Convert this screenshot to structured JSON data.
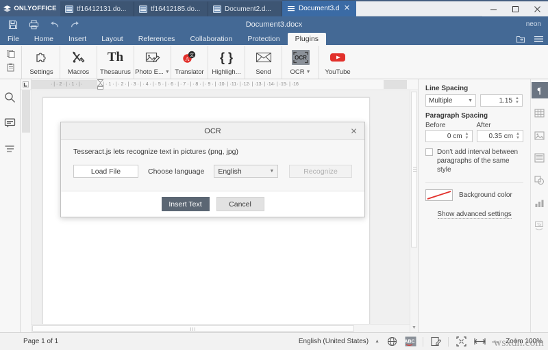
{
  "app": {
    "brand": "ONLYOFFICE",
    "user": "neon",
    "document_title": "Document3.docx"
  },
  "tabs": [
    {
      "label": "tf16412131.do...",
      "active": false
    },
    {
      "label": "tf16412185.do...",
      "active": false
    },
    {
      "label": "Document2.d...",
      "active": false
    },
    {
      "label": "Document3.d...",
      "active": true
    }
  ],
  "window_buttons": {
    "minimize": "—",
    "maximize": "☐",
    "close": "✕"
  },
  "quick_access": [
    "save-icon",
    "print-icon",
    "undo-icon",
    "redo-icon"
  ],
  "menu": {
    "items": [
      {
        "label": "File",
        "active": false
      },
      {
        "label": "Home",
        "active": false
      },
      {
        "label": "Insert",
        "active": false
      },
      {
        "label": "Layout",
        "active": false
      },
      {
        "label": "References",
        "active": false
      },
      {
        "label": "Collaboration",
        "active": false
      },
      {
        "label": "Protection",
        "active": false
      },
      {
        "label": "Plugins",
        "active": true
      }
    ]
  },
  "ribbon": {
    "plugins": [
      {
        "label": "Settings",
        "icon": "puzzle-icon",
        "caret": false,
        "selected": false
      },
      {
        "label": "Macros",
        "icon": "tools-icon",
        "caret": false,
        "selected": false
      },
      {
        "label": "Thesaurus",
        "icon": "th-icon",
        "caret": false,
        "selected": false
      },
      {
        "label": "Photo E...",
        "icon": "photo-editor-icon",
        "caret": true,
        "selected": false
      },
      {
        "label": "Translator",
        "icon": "translator-icon",
        "caret": false,
        "selected": false
      },
      {
        "label": "Highligh...",
        "icon": "braces-icon",
        "caret": false,
        "selected": false
      },
      {
        "label": "Send",
        "icon": "envelope-icon",
        "caret": false,
        "selected": false
      },
      {
        "label": "OCR",
        "icon": "ocr-icon",
        "caret": true,
        "selected": true
      },
      {
        "label": "YouTube",
        "icon": "youtube-icon",
        "caret": false,
        "selected": false
      }
    ]
  },
  "left_rail": [
    {
      "name": "search-icon"
    },
    {
      "name": "comments-icon"
    },
    {
      "name": "headings-icon"
    }
  ],
  "right_rail": [
    {
      "name": "paragraph-settings-icon",
      "active": true
    },
    {
      "name": "table-settings-icon",
      "active": false
    },
    {
      "name": "image-settings-icon",
      "active": false
    },
    {
      "name": "header-footer-settings-icon",
      "active": false
    },
    {
      "name": "shape-settings-icon",
      "active": false
    },
    {
      "name": "chart-settings-icon",
      "active": false
    },
    {
      "name": "text-art-settings-icon",
      "active": false
    }
  ],
  "right_panel": {
    "line_spacing_title": "Line Spacing",
    "line_spacing_mode": "Multiple",
    "line_spacing_value": "1.15",
    "paragraph_spacing_title": "Paragraph Spacing",
    "before_label": "Before",
    "after_label": "After",
    "before_value": "0 cm",
    "after_value": "0.35 cm",
    "no_interval_text": "Don't add interval between paragraphs of the same style",
    "background_color_label": "Background color",
    "advanced_label": "Show advanced settings"
  },
  "ruler": {
    "horizontal_ticks": "· | · 2 · | · 1 · | ·",
    "horizontal_scale": "· | · 1 · | · 2 · | · 3 · | · 4 · | · 5 · | · 6 · | · 7 · | · 8 · | · 9 · | ·10· | ·11· | ·12· | ·13· | ·14· | ·15· | ·16"
  },
  "modal": {
    "title": "OCR",
    "close": "✕",
    "description": "Tesseract.js lets recognize text in pictures (png, jpg)",
    "load_file_label": "Load File",
    "choose_language_label": "Choose language",
    "language_value": "English",
    "recognize_label": "Recognize",
    "insert_text_label": "Insert Text",
    "cancel_label": "Cancel"
  },
  "statusbar": {
    "page_info": "Page 1 of 1",
    "language": "English (United States)",
    "zoom_label": "Zoom 100%",
    "zoom_out": "—",
    "icons": [
      "globe-icon",
      "spellcheck-icon",
      "track-changes-icon",
      "fit-page-icon",
      "fit-width-icon"
    ]
  },
  "watermark": "wsxdn.com",
  "colors": {
    "titlebar": "#445e80",
    "header": "#446995",
    "active_tab": "#3b6ba5",
    "accent_red": "#e2302b",
    "primary_button": "#5b6673"
  }
}
